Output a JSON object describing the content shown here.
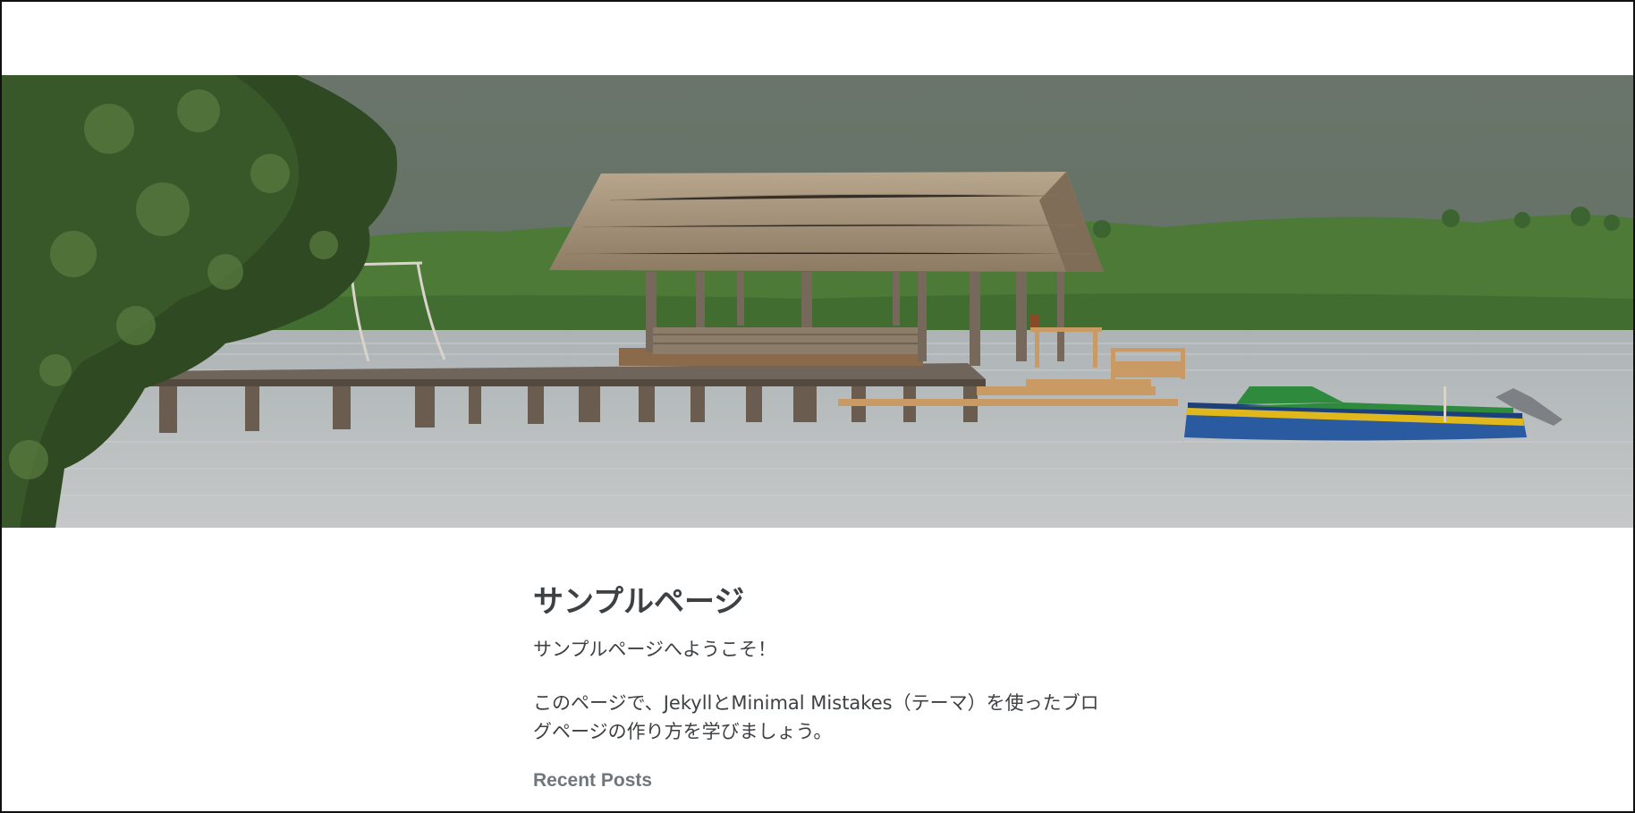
{
  "page": {
    "title": "サンプルページ",
    "intro": "サンプルページへようこそ！",
    "body": "このページで、JekyllとMinimal Mistakes（テーマ）を使ったブログページの作り方を学びましょう。",
    "recent_posts_heading": "Recent Posts"
  },
  "hero": {
    "image_subject": "thatched-hut-on-pier-over-water",
    "colors": {
      "mountain": "#5e6a5d",
      "forest": "#4f7a3a",
      "water": "#b8bcbd",
      "thatch": "#a8957a",
      "pier": "#6e6358",
      "boat_green": "#2e8b3e",
      "boat_blue": "#2a5aa0",
      "boat_yellow": "#e0b81c"
    }
  }
}
